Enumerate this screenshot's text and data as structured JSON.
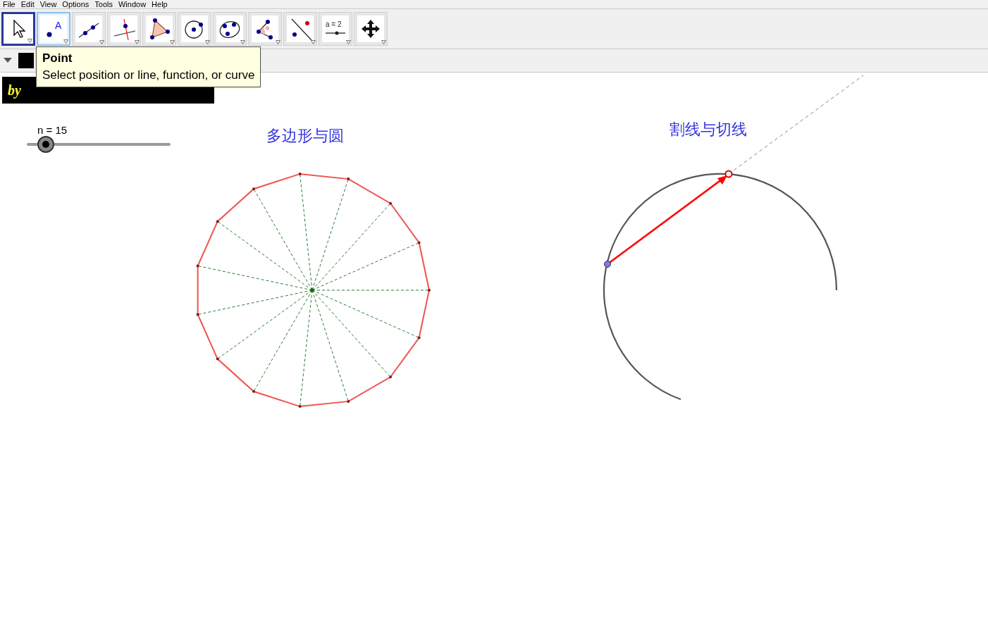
{
  "menu": [
    "File",
    "Edit",
    "View",
    "Options",
    "Tools",
    "Window",
    "Help"
  ],
  "tools": [
    {
      "kind": "move",
      "selected": true,
      "hovered": false
    },
    {
      "kind": "point",
      "selected": false,
      "hovered": true,
      "label": "A"
    },
    {
      "kind": "line",
      "selected": false,
      "hovered": false
    },
    {
      "kind": "perpendicular",
      "selected": false,
      "hovered": false
    },
    {
      "kind": "polygon",
      "selected": false,
      "hovered": false
    },
    {
      "kind": "circle",
      "selected": false,
      "hovered": false
    },
    {
      "kind": "conic",
      "selected": false,
      "hovered": false
    },
    {
      "kind": "angle",
      "selected": false,
      "hovered": false,
      "label": "α"
    },
    {
      "kind": "reflect",
      "selected": false,
      "hovered": false
    },
    {
      "kind": "slider",
      "selected": false,
      "hovered": false,
      "label": "a = 2"
    },
    {
      "kind": "pan",
      "selected": false,
      "hovered": false
    }
  ],
  "tooltip": {
    "title": "Point",
    "text": "Select position or line, function, or curve"
  },
  "author_banner": "by",
  "slider": {
    "label": "n = 15"
  },
  "titles": [
    "多边形与圆",
    "割线与切线"
  ]
}
